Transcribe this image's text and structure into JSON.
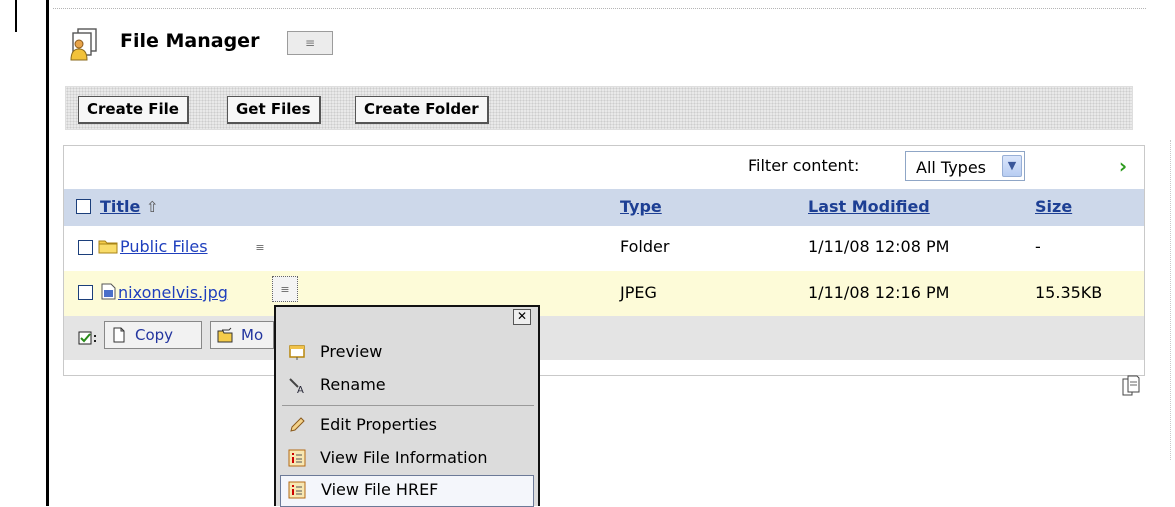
{
  "header": {
    "title": "File Manager"
  },
  "toolbar": {
    "buttons": [
      {
        "label": "Create File"
      },
      {
        "label": "Get Files"
      },
      {
        "label": "Create Folder"
      }
    ]
  },
  "filter": {
    "label": "Filter content:",
    "selected": "All Types"
  },
  "table": {
    "columns": {
      "title": "Title",
      "type": "Type",
      "modified": "Last Modified",
      "size": "Size"
    },
    "rows": [
      {
        "name": "Public Files",
        "type": "Folder",
        "modified": "1/11/08 12:08 PM",
        "size": "-",
        "icon": "folder-icon"
      },
      {
        "name": "nixonelvis.jpg",
        "type": "JPEG",
        "modified": "1/11/08 12:16 PM",
        "size": "15.35KB",
        "icon": "image-file-icon"
      }
    ]
  },
  "actions": {
    "copy": "Copy",
    "move": "Mo"
  },
  "context_menu": {
    "items": [
      {
        "label": "Preview",
        "icon": "preview-icon"
      },
      {
        "label": "Rename",
        "icon": "rename-icon"
      },
      {
        "label": "Edit Properties",
        "icon": "pencil-icon"
      },
      {
        "label": "View File Information",
        "icon": "info-icon"
      },
      {
        "label": "View File HREF",
        "icon": "info-icon"
      }
    ]
  },
  "colors": {
    "header_row": "#cdd8ea",
    "selected_row": "#fdfbd8",
    "link": "#1f3fbd",
    "column_header": "#1d3f94"
  }
}
